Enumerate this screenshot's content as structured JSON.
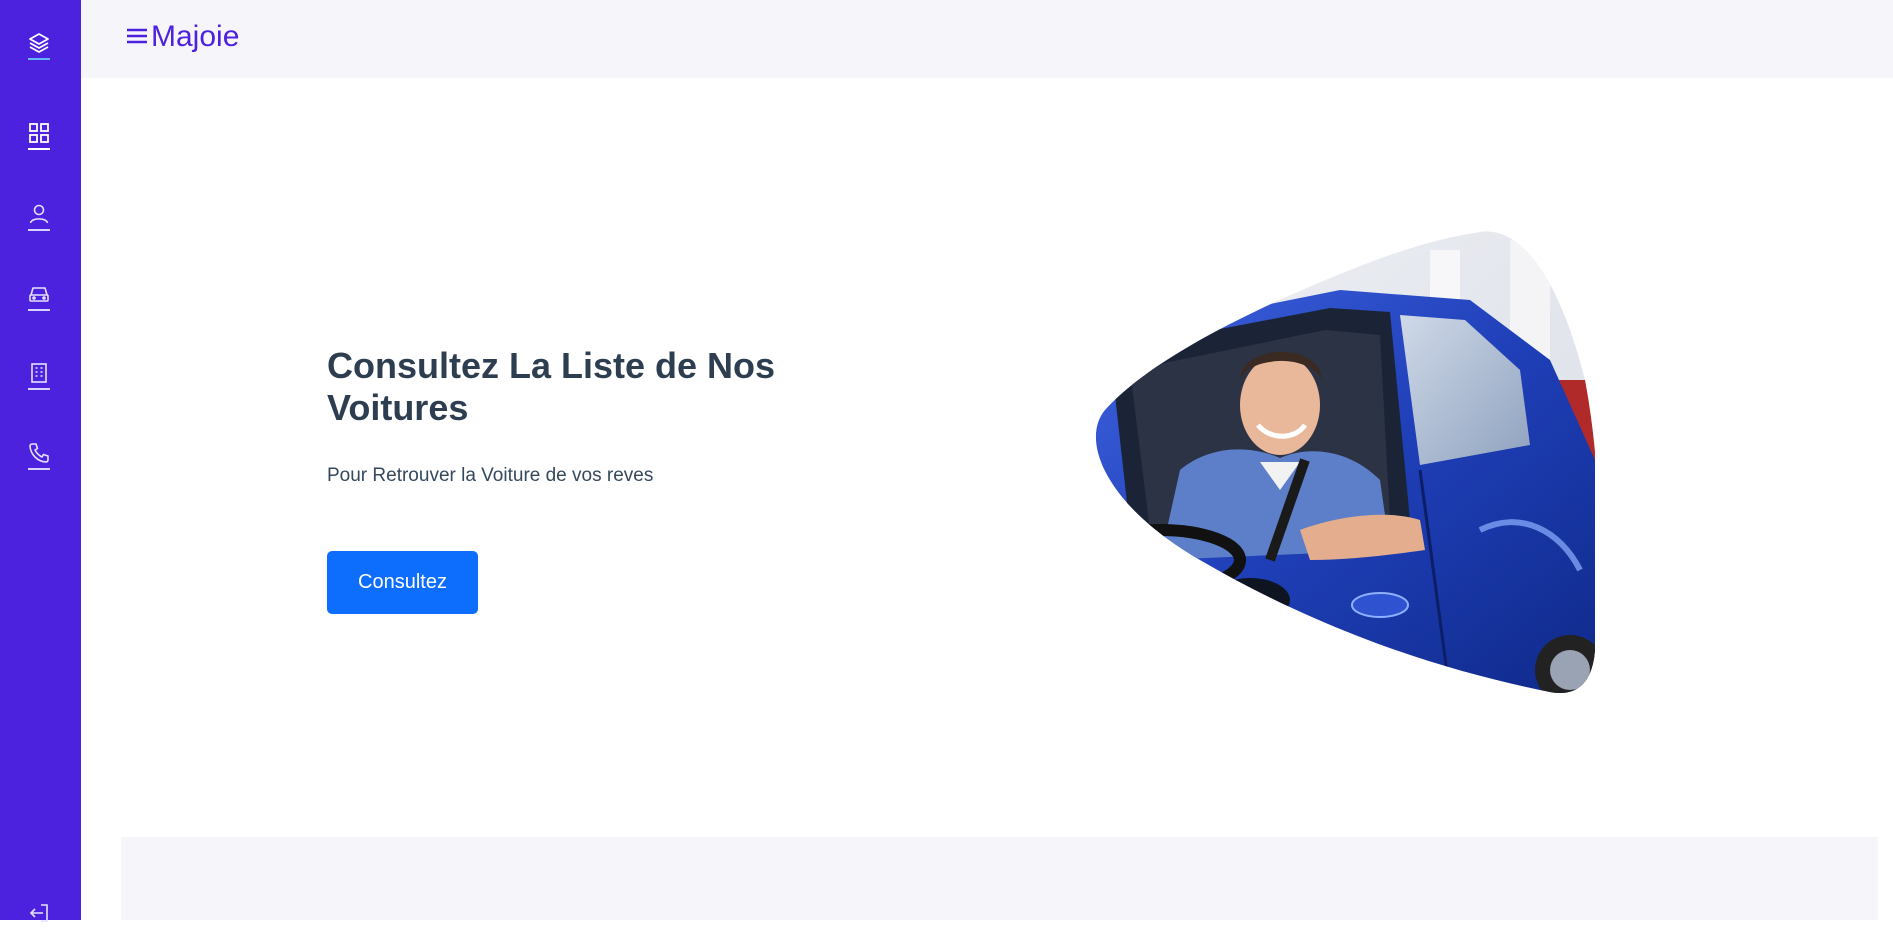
{
  "app": {
    "brand": "Majoie"
  },
  "sidebar": {
    "items": [
      {
        "icon": "layers-icon"
      },
      {
        "icon": "dashboard-grid-icon"
      },
      {
        "icon": "user-icon"
      },
      {
        "icon": "car-icon"
      },
      {
        "icon": "building-icon"
      },
      {
        "icon": "phone-icon"
      },
      {
        "icon": "logout-icon"
      }
    ]
  },
  "hero": {
    "title": "Consultez La Liste de Nos Voitures",
    "subtitle": "Pour Retrouver la Voiture de vos reves",
    "button_label": "Consultez",
    "image": "smiling-man-in-blue-car"
  },
  "colors": {
    "sidebar": "#4c22df",
    "brand_text": "#4c22df",
    "button": "#0d6efd",
    "title": "#2c3e50"
  }
}
